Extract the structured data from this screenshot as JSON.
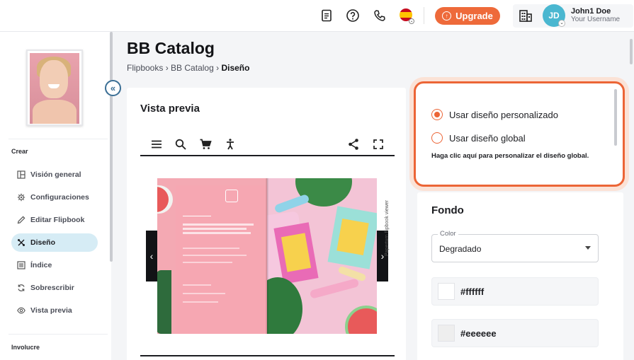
{
  "header": {
    "upgrade_label": "Upgrade",
    "user_initials": "JD",
    "user_name": "John1 Doe",
    "user_sub": "Your Username",
    "icons": [
      "document-icon",
      "help-icon",
      "phone-icon",
      "spain-flag-icon",
      "building-icon"
    ]
  },
  "sidebar": {
    "section_create": "Crear",
    "section_involve": "Involucre",
    "items": [
      {
        "label": "Visión general",
        "icon": "layout-icon"
      },
      {
        "label": "Configuraciones",
        "icon": "gear-icon"
      },
      {
        "label": "Editar Flipbook",
        "icon": "pencil-icon"
      },
      {
        "label": "Diseño",
        "icon": "design-icon",
        "active": true
      },
      {
        "label": "Índice",
        "icon": "list-icon"
      },
      {
        "label": "Sobrescribir",
        "icon": "refresh-icon"
      },
      {
        "label": "Vista previa",
        "icon": "eye-icon"
      }
    ]
  },
  "page": {
    "title": "BB Catalog",
    "breadcrumb": [
      "Flipbooks",
      "BB Catalog",
      "Diseño"
    ]
  },
  "preview": {
    "title": "Vista previa",
    "watermark": "Paperturn flipbook viewer"
  },
  "design": {
    "option_custom": "Usar diseño personalizado",
    "option_global": "Usar diseño global",
    "selected": "custom",
    "note": "Haga clic aquí para personalizar el diseño global."
  },
  "fondo": {
    "title": "Fondo",
    "color_label": "Color",
    "color_value": "Degradado",
    "colors": [
      "#ffffff",
      "#eeeeee"
    ]
  },
  "colors": {
    "accent": "#ec6536",
    "active_nav": "#d6ecf5",
    "avatar": "#4ab7d0"
  }
}
